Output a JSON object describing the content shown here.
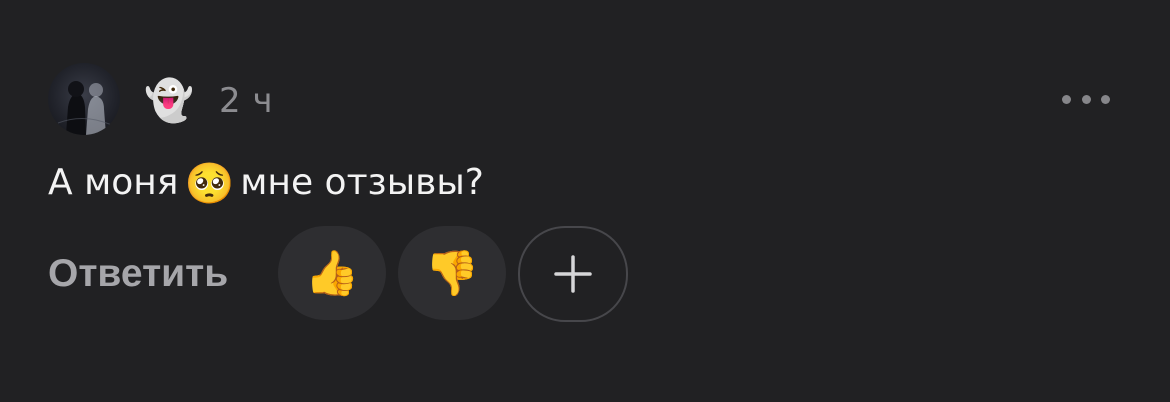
{
  "comment": {
    "author_emoji": "👻",
    "time": "2 ч",
    "text_before": "А моня",
    "text_emoji": "🥺",
    "text_after": "мне отзывы?"
  },
  "actions": {
    "reply_label": "Ответить",
    "reaction_up": "👍",
    "reaction_down": "👎",
    "add_reaction_icon": "plus-icon"
  },
  "icons": {
    "more": "more-horizontal-icon"
  },
  "colors": {
    "background": "#212123",
    "text": "#f3f3f3",
    "muted": "#8c8c90",
    "pill": "#2e2e31"
  }
}
